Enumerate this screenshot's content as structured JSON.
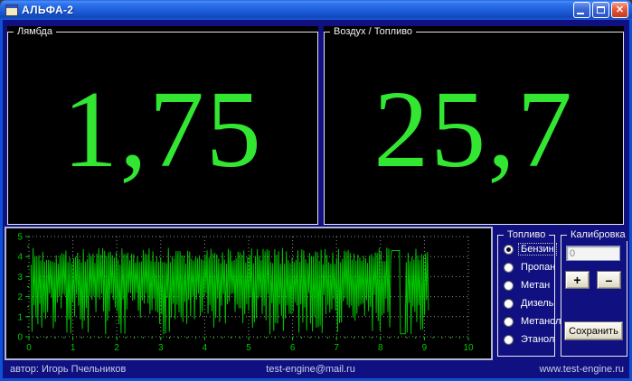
{
  "window": {
    "title": "АЛЬФА-2",
    "icon": "form-icon",
    "controls": {
      "minimize": "minimize-icon",
      "maximize": "maximize-icon",
      "close": "close-icon"
    }
  },
  "displays": {
    "lambda": {
      "caption": "Лямбда",
      "value": "1,75"
    },
    "air_fuel": {
      "caption": "Воздух / Топливо",
      "value": "25,7"
    }
  },
  "chart_data": {
    "type": "line",
    "title": "",
    "xlabel": "",
    "ylabel": "",
    "xlim": [
      0,
      10
    ],
    "ylim": [
      0,
      5
    ],
    "xticks": [
      0,
      1,
      2,
      3,
      4,
      5,
      6,
      7,
      8,
      9,
      10
    ],
    "yticks": [
      0,
      1,
      2,
      3,
      4,
      5
    ],
    "grid": true,
    "legend": "none",
    "background": "#000000",
    "line_color": "#00c300",
    "label_color": "#00cc00",
    "grid_color": "#8f8f8f",
    "description": "Dense oscillating lambda-sensor trace from x=0 to x=9.1; rapid vertical swings between ~0.1-2.2 (lower tips) and ~3.6-4.45 (upper peaks); flat-top pulse at ~4.3 between x=8.25 and x=8.45; quiet gap near 0.15 from x=8.45 to 8.58; no data from 9.1 to 10.",
    "signal": {
      "seed": 7,
      "x_start": 0.05,
      "x_end": 9.1,
      "step": 0.022,
      "low_min": 0.12,
      "low_max": 2.2,
      "high_min": 3.58,
      "high_max": 4.45,
      "flat_x0": 8.25,
      "flat_x1": 8.45,
      "flat_y": 4.3,
      "gap_x0": 8.45,
      "gap_x1": 8.58,
      "gap_y": 0.15
    }
  },
  "fuel": {
    "caption": "Топливо",
    "items": [
      {
        "label": "Бензин",
        "selected": true
      },
      {
        "label": "Пропан",
        "selected": false
      },
      {
        "label": "Метан",
        "selected": false
      },
      {
        "label": "Дизель",
        "selected": false
      },
      {
        "label": "Метанол",
        "selected": false
      },
      {
        "label": "Этанол",
        "selected": false
      }
    ]
  },
  "calibration": {
    "caption": "Калибровка",
    "field_value": "0",
    "plus_label": "+",
    "minus_label": "–",
    "save_label": "Сохранить"
  },
  "statusbar": {
    "author": "автор: Игорь Пчельников",
    "email": "test-engine@mail.ru",
    "site": "www.test-engine.ru"
  },
  "colors": {
    "body_background": "#101080",
    "display_background": "#000000",
    "display_green": "#32e632",
    "titlebar_blue": "#1b59d6",
    "close_red": "#e4573a",
    "button_face": "#ece9d8",
    "status_text": "#c6cee8"
  }
}
